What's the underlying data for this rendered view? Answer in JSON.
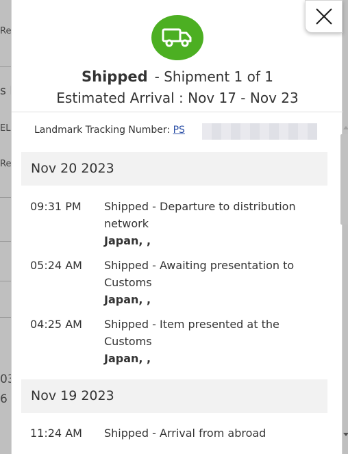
{
  "background": {
    "fragments": [
      "Re",
      "s E",
      "EL",
      "Re",
      "03",
      "6"
    ]
  },
  "modal": {
    "status": "Shipped",
    "shipment_label": "- Shipment 1 of 1",
    "arrival_label": "Estimated Arrival : Nov 17 - Nov 23",
    "tracking_label": "Landmark Tracking Number:",
    "tracking_number": "PS",
    "close_icon": "close-icon",
    "truck_icon": "truck-icon",
    "accent_color": "#4caf22"
  },
  "groups": [
    {
      "date": "Nov 20 2023",
      "events": [
        {
          "time": "09:31 PM",
          "desc": "Shipped - Departure to distribution network",
          "loc": "Japan, ,"
        },
        {
          "time": "05:24 AM",
          "desc": "Shipped - Awaiting presentation to Customs",
          "loc": "Japan, ,"
        },
        {
          "time": "04:25 AM",
          "desc": "Shipped - Item presented at the Customs",
          "loc": "Japan, ,"
        }
      ]
    },
    {
      "date": "Nov 19 2023",
      "events": [
        {
          "time": "11:24 AM",
          "desc": "Shipped - Arrival from abroad",
          "loc": ""
        }
      ]
    }
  ]
}
